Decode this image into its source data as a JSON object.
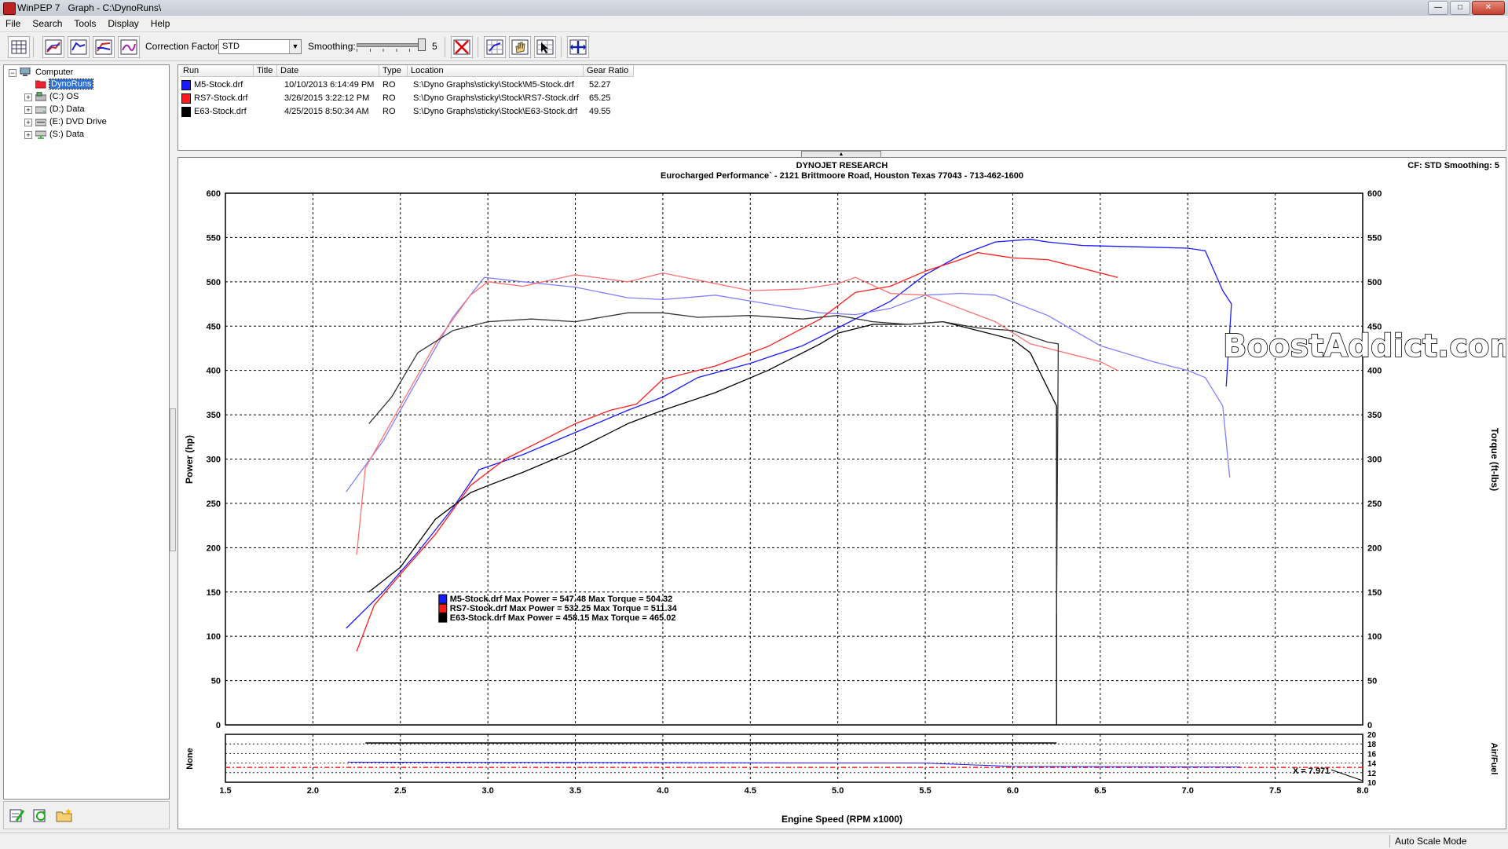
{
  "window": {
    "app_title": "WinPEP 7",
    "doc_title": "Graph - C:\\DynoRuns\\",
    "controls": {
      "minimize": "—",
      "maximize": "□",
      "close": "✕"
    }
  },
  "menu": {
    "items": [
      "File",
      "Search",
      "Tools",
      "Display",
      "Help"
    ]
  },
  "toolbar": {
    "correction_label": "Correction Factor:",
    "correction_value": "STD",
    "smoothing_label": "Smoothing:",
    "smoothing_value": "5",
    "smoothing_level": 5,
    "smoothing_max": 5
  },
  "tree": {
    "root": "Computer",
    "selected": "DynoRuns",
    "drives": [
      "(C:) OS",
      "(D:) Data",
      "(E:) DVD Drive",
      "(S:) Data"
    ]
  },
  "run_table": {
    "headers": [
      "Run",
      "Title",
      "Date",
      "Type",
      "Location",
      "Gear Ratio"
    ],
    "rows": [
      {
        "run": "M5-Stock.drf",
        "title": "",
        "date": "10/10/2013 6:14:49 PM",
        "type": "RO",
        "location": "S:\\Dyno Graphs\\sticky\\Stock\\M5-Stock.drf",
        "gear_ratio": "52.27",
        "color": "#1a1aff"
      },
      {
        "run": "RS7-Stock.drf",
        "title": "",
        "date": "3/26/2015 3:22:12 PM",
        "type": "RO",
        "location": "S:\\Dyno Graphs\\sticky\\Stock\\RS7-Stock.drf",
        "gear_ratio": "65.25",
        "color": "#ff1a1a"
      },
      {
        "run": "E63-Stock.drf",
        "title": "",
        "date": "4/25/2015 8:50:34 AM",
        "type": "RO",
        "location": "S:\\Dyno Graphs\\sticky\\Stock\\E63-Stock.drf",
        "gear_ratio": "49.55",
        "color": "#000000"
      }
    ]
  },
  "graph": {
    "header": "DYNOJET RESEARCH",
    "subheader": "Eurocharged Performance` - 2121 Brittmoore Road, Houston Texas 77043 - 713-462-1600",
    "cf_label": "CF: STD  Smoothing: 5",
    "watermark": "BoostAddict.com",
    "lower_left_label": "None",
    "cursor_label": "X = 7.971"
  },
  "status": {
    "mode": "Auto Scale Mode"
  },
  "chart_data": {
    "type": "line",
    "xlabel": "Engine Speed (RPM x1000)",
    "ylabel_left": "Power (hp)",
    "ylabel_right": "Torque (ft-lbs)",
    "ylabel_lower_right": "Air/Fuel",
    "xlim": [
      1.5,
      8.0
    ],
    "ylim": [
      0,
      600
    ],
    "x_ticks": [
      "1.5",
      "2.0",
      "2.5",
      "3.0",
      "3.5",
      "4.0",
      "4.5",
      "5.0",
      "5.5",
      "6.0",
      "6.5",
      "7.0",
      "7.5",
      "8.0"
    ],
    "y_ticks": [
      "0",
      "50",
      "100",
      "150",
      "200",
      "250",
      "300",
      "350",
      "400",
      "450",
      "500",
      "550",
      "600"
    ],
    "lower_ylim": [
      10,
      20
    ],
    "lower_y_ticks": [
      "10",
      "12",
      "14",
      "16",
      "18",
      "20"
    ],
    "grid": true,
    "legend": [
      {
        "text": "M5-Stock.drf Max Power = 547.48 Max Torque = 504.32",
        "color": "#1a1aff"
      },
      {
        "text": "RS7-Stock.drf Max Power = 532.25 Max Torque = 511.34",
        "color": "#ff1a1a"
      },
      {
        "text": "E63-Stock.drf Max Power = 458.15 Max Torque = 465.02",
        "color": "#000000"
      }
    ],
    "series": [
      {
        "name": "M5-Stock.drf",
        "measure": "Power",
        "color": "#1a1aff",
        "x": [
          2.19,
          2.4,
          2.6,
          2.8,
          2.95,
          3.2,
          3.5,
          3.8,
          4.0,
          4.2,
          4.5,
          4.8,
          5.0,
          5.3,
          5.5,
          5.7,
          5.9,
          6.1,
          6.2,
          6.4,
          6.6,
          6.8,
          7.0,
          7.1,
          7.2,
          7.25,
          7.22
        ],
        "y": [
          109,
          150,
          195,
          245,
          288,
          305,
          330,
          355,
          370,
          392,
          408,
          428,
          448,
          478,
          508,
          530,
          545,
          548,
          545,
          541,
          540,
          539,
          538,
          535,
          490,
          475,
          382
        ]
      },
      {
        "name": "M5-Stock.drf",
        "measure": "Torque",
        "color": "#8080ff",
        "x": [
          2.19,
          2.4,
          2.6,
          2.8,
          2.98,
          3.2,
          3.5,
          3.8,
          4.0,
          4.3,
          4.6,
          4.9,
          5.1,
          5.3,
          5.5,
          5.7,
          5.9,
          6.2,
          6.5,
          6.8,
          7.0,
          7.1,
          7.2,
          7.24
        ],
        "y": [
          263,
          320,
          390,
          460,
          505,
          500,
          494,
          482,
          480,
          485,
          475,
          465,
          463,
          470,
          485,
          487,
          485,
          462,
          428,
          410,
          400,
          392,
          360,
          279
        ]
      },
      {
        "name": "RS7-Stock.drf",
        "measure": "Power",
        "color": "#ff1a1a",
        "x": [
          2.25,
          2.35,
          2.5,
          2.7,
          2.9,
          3.1,
          3.3,
          3.5,
          3.7,
          3.85,
          4.0,
          4.3,
          4.6,
          4.9,
          5.1,
          5.3,
          5.5,
          5.7,
          5.8,
          6.0,
          6.2,
          6.4,
          6.6
        ],
        "y": [
          83,
          135,
          170,
          215,
          270,
          300,
          320,
          340,
          355,
          362,
          390,
          405,
          427,
          458,
          488,
          495,
          512,
          525,
          533,
          527,
          525,
          515,
          505
        ]
      },
      {
        "name": "RS7-Stock.drf",
        "measure": "Torque",
        "color": "#ff7070",
        "x": [
          2.25,
          2.3,
          2.5,
          2.7,
          2.9,
          3.0,
          3.2,
          3.5,
          3.8,
          4.0,
          4.2,
          4.5,
          4.8,
          5.0,
          5.1,
          5.3,
          5.5,
          5.7,
          5.9,
          6.1,
          6.3,
          6.5,
          6.6
        ],
        "y": [
          192,
          290,
          360,
          430,
          485,
          500,
          495,
          508,
          500,
          510,
          502,
          490,
          492,
          498,
          505,
          487,
          485,
          470,
          455,
          430,
          420,
          410,
          400
        ]
      },
      {
        "name": "E63-Stock.drf",
        "measure": "Power",
        "color": "#000000",
        "x": [
          2.32,
          2.5,
          2.7,
          2.9,
          3.0,
          3.2,
          3.5,
          3.8,
          4.0,
          4.3,
          4.6,
          4.9,
          5.0,
          5.2,
          5.4,
          5.6,
          5.8,
          6.0,
          6.1,
          6.2,
          6.25,
          6.25
        ],
        "y": [
          150,
          178,
          232,
          262,
          270,
          285,
          310,
          340,
          355,
          375,
          400,
          430,
          442,
          452,
          452,
          455,
          445,
          435,
          420,
          380,
          360,
          0
        ]
      },
      {
        "name": "E63-Stock.drf",
        "measure": "Torque",
        "color": "#333333",
        "x": [
          2.32,
          2.45,
          2.6,
          2.8,
          3.0,
          3.25,
          3.5,
          3.8,
          4.0,
          4.2,
          4.5,
          4.8,
          5.0,
          5.2,
          5.4,
          5.6,
          5.8,
          6.0,
          6.2,
          6.26,
          6.25
        ],
        "y": [
          340,
          370,
          420,
          445,
          455,
          458,
          455,
          465,
          465,
          460,
          462,
          458,
          462,
          455,
          452,
          455,
          448,
          445,
          432,
          430,
          125
        ]
      }
    ]
  }
}
